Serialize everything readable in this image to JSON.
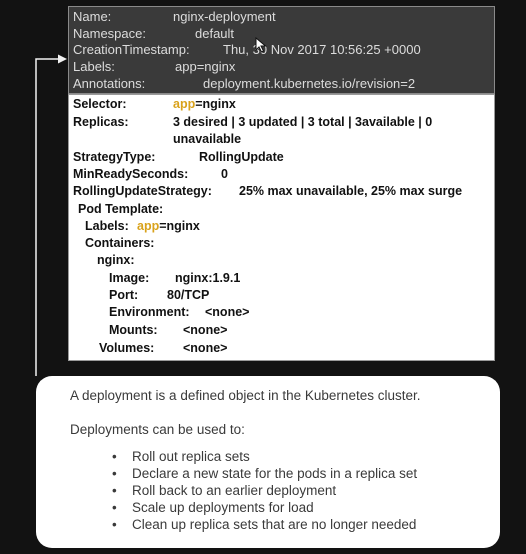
{
  "metadata": {
    "name": {
      "key": "Name:",
      "value": "nginx-deployment"
    },
    "namespace": {
      "key": "Namespace:",
      "value": "default"
    },
    "creation": {
      "key": "CreationTimestamp:",
      "value": "Thu, 30 Nov 2017 10:56:25 +0000"
    },
    "labels": {
      "key": "Labels:",
      "value": "app=nginx"
    },
    "annotations": {
      "key": "Annotations:",
      "value": "deployment.kubernetes.io/revision=2"
    }
  },
  "details": {
    "selector": {
      "key": "Selector:",
      "hl": "app",
      "rest": "=nginx"
    },
    "replicas": {
      "key": "Replicas:",
      "line1": "3 desired | 3 updated | 3 total | 3available | 0",
      "line2": "unavailable"
    },
    "strategy_type": {
      "key": "StrategyType:",
      "value": "RollingUpdate"
    },
    "min_ready": {
      "key": "MinReadySeconds:",
      "value": "0"
    },
    "rolling_update": {
      "key": "RollingUpdateStrategy:",
      "value": "25% max unavailable, 25% max surge"
    },
    "pod_template": {
      "key": "Pod Template:"
    },
    "pod_labels": {
      "key": "Labels:",
      "hl": "app",
      "rest": "=nginx"
    },
    "containers": {
      "key": "Containers:"
    },
    "container_name": {
      "key": "nginx:"
    },
    "image": {
      "key": "Image:",
      "value": "nginx:1.9.1"
    },
    "port": {
      "key": "Port:",
      "value": "80/TCP"
    },
    "environment": {
      "key": "Environment:",
      "value": "<none>"
    },
    "mounts": {
      "key": "Mounts:",
      "value": "<none>"
    },
    "volumes": {
      "key": "Volumes:",
      "value": "<none>"
    }
  },
  "info": {
    "intro": "A deployment is a defined object in the Kubernetes cluster.",
    "sub": "Deployments can be used to:",
    "bullet_char": "•",
    "items": [
      "Roll out replica sets",
      "Declare a new state for the pods in a replica set",
      "Roll back to an earlier deployment",
      "Scale up deployments for load",
      "Clean up replica sets that are no longer needed"
    ]
  },
  "colors": {
    "background": "#121212",
    "metadata_panel": "#3a3a3a",
    "highlight": "#d9a21b",
    "card": "#ffffff"
  }
}
